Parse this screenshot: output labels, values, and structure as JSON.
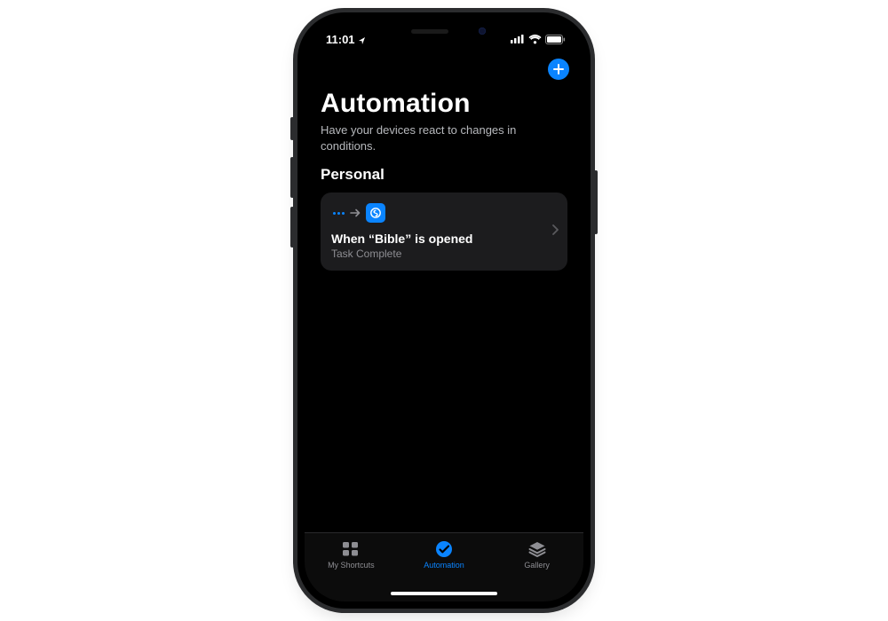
{
  "status_bar": {
    "time": "11:01"
  },
  "header": {
    "title": "Automation",
    "subtitle": "Have your devices react to changes in conditions."
  },
  "section": {
    "title": "Personal"
  },
  "automations": [
    {
      "title": "When “Bible” is opened",
      "subtitle": "Task Complete"
    }
  ],
  "tab_bar": {
    "items": [
      {
        "label": "My Shortcuts",
        "active": false
      },
      {
        "label": "Automation",
        "active": true
      },
      {
        "label": "Gallery",
        "active": false
      }
    ]
  },
  "colors": {
    "accent": "#0a84ff"
  }
}
